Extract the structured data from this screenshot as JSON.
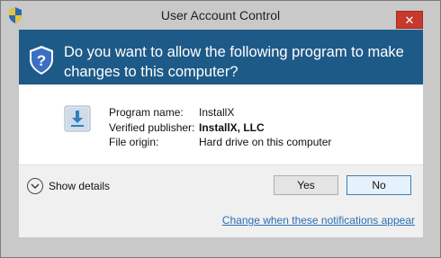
{
  "window": {
    "title": "User Account Control",
    "close_label": "✕"
  },
  "header": {
    "question": "Do you want to allow the following program to make changes to this computer?"
  },
  "program_info": {
    "name_label": "Program name:",
    "publisher_label": "Verified publisher:",
    "origin_label": "File origin:",
    "name_value": "InstallX",
    "publisher_value": "InstallX, LLC",
    "origin_value": "Hard drive on this computer"
  },
  "footer": {
    "details_label": "Show details",
    "yes_label": "Yes",
    "no_label": "No",
    "link_label": "Change when these notifications appear"
  },
  "colors": {
    "header_bg": "#1e5a88",
    "close_bg": "#c7392c",
    "link": "#2a6fb5"
  },
  "icons": {
    "title": "uac-shield-icon",
    "header": "uac-shield-icon",
    "program": "installer-download-icon",
    "details": "chevron-down-icon"
  }
}
